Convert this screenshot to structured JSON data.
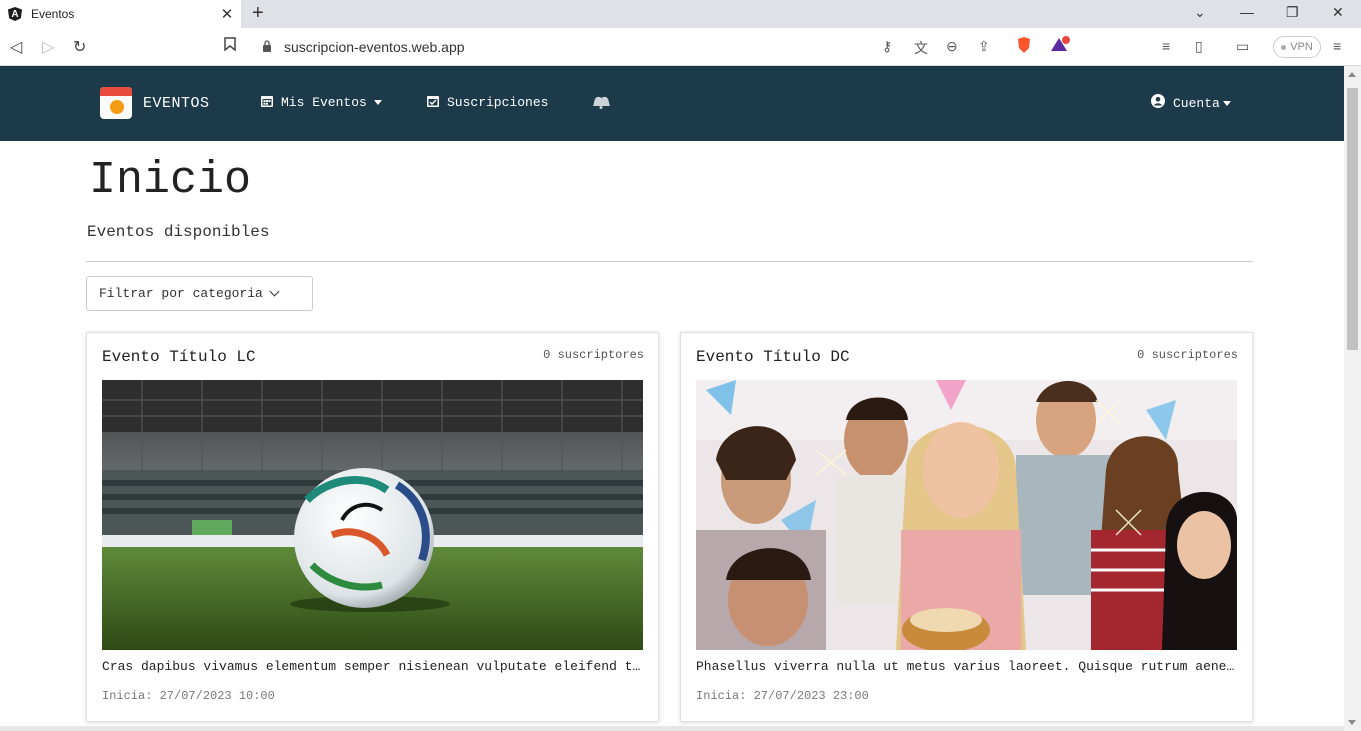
{
  "browser": {
    "tab_title": "Eventos",
    "tab_close": "✕",
    "new_tab": "+",
    "url": "suscripcion-eventos.web.app",
    "vpn_label": "VPN",
    "brave_badge": "1",
    "window_controls": {
      "tab_search": "⌄",
      "minimize": "—",
      "restore": "❐",
      "close": "✕"
    }
  },
  "navbar": {
    "brand": "EVENTOS",
    "items": [
      {
        "label": "Mis Eventos",
        "icon": "calendar-icon",
        "dropdown": true
      },
      {
        "label": "Suscripciones",
        "icon": "calendar-check-icon",
        "dropdown": false
      },
      {
        "icon": "bells-icon"
      }
    ],
    "account_label": "Cuenta",
    "bg_color": "#1c3a4a"
  },
  "page": {
    "title": "Inicio",
    "subtitle": "Eventos disponibles",
    "filter_label": "Filtrar por categoria"
  },
  "events": [
    {
      "title": "Evento Título LC",
      "subscribers": "0 suscriptores",
      "image": "soccer-ball-stadium",
      "description": "Cras dapibus vivamus elementum semper nisienean vulputate eleifend tellus.",
      "date": "Inicia: 27/07/2023 10:00"
    },
    {
      "title": "Evento Título DC",
      "subscribers": "0 suscriptores",
      "image": "birthday-party-group",
      "description": "Phasellus viverra nulla ut metus varius laoreet. Quisque rutrum aenean imperdiet.",
      "date": "Inicia: 27/07/2023 23:00"
    }
  ]
}
